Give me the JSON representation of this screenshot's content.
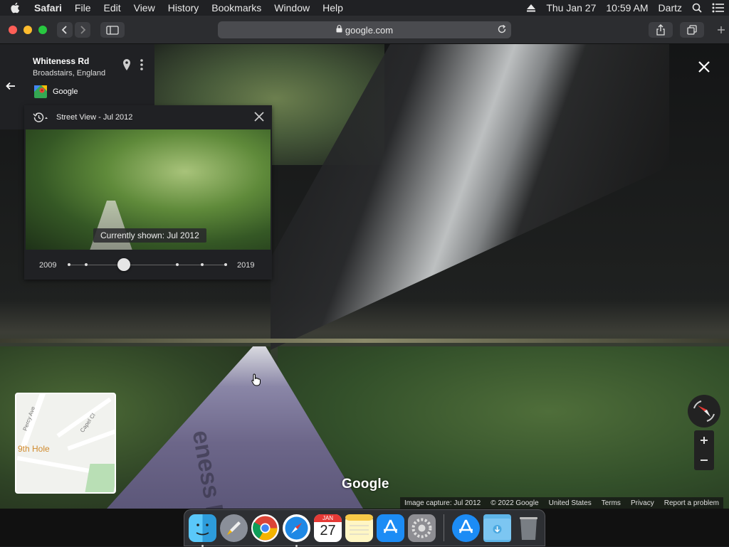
{
  "menubar": {
    "app": "Safari",
    "items": [
      "File",
      "Edit",
      "View",
      "History",
      "Bookmarks",
      "Window",
      "Help"
    ],
    "date": "Thu Jan 27",
    "time": "10:59 AM",
    "user": "Dartz"
  },
  "browser": {
    "url": "google.com"
  },
  "place": {
    "title": "Whiteness Rd",
    "subtitle": "Broadstairs, England",
    "provider": "Google"
  },
  "timeline": {
    "title": "Street View - Jul 2012",
    "current": "Currently shown: Jul 2012",
    "start_year": "2009",
    "end_year": "2019",
    "ticks": [
      0,
      0.11,
      0.35,
      0.69,
      0.85,
      1.0
    ],
    "selected_fraction": 0.35
  },
  "street": {
    "road_label": "eness Rd"
  },
  "minimap": {
    "poi": "9th Hole",
    "labels": [
      "Percy Ave",
      "Capel Cl"
    ]
  },
  "map": {
    "logo": "Google"
  },
  "footer": {
    "capture": "Image capture: Jul 2012",
    "copyright": "© 2022 Google",
    "region": "United States",
    "terms": "Terms",
    "privacy": "Privacy",
    "report": "Report a problem"
  },
  "dock": {
    "calendar_month": "JAN",
    "calendar_day": "27"
  }
}
